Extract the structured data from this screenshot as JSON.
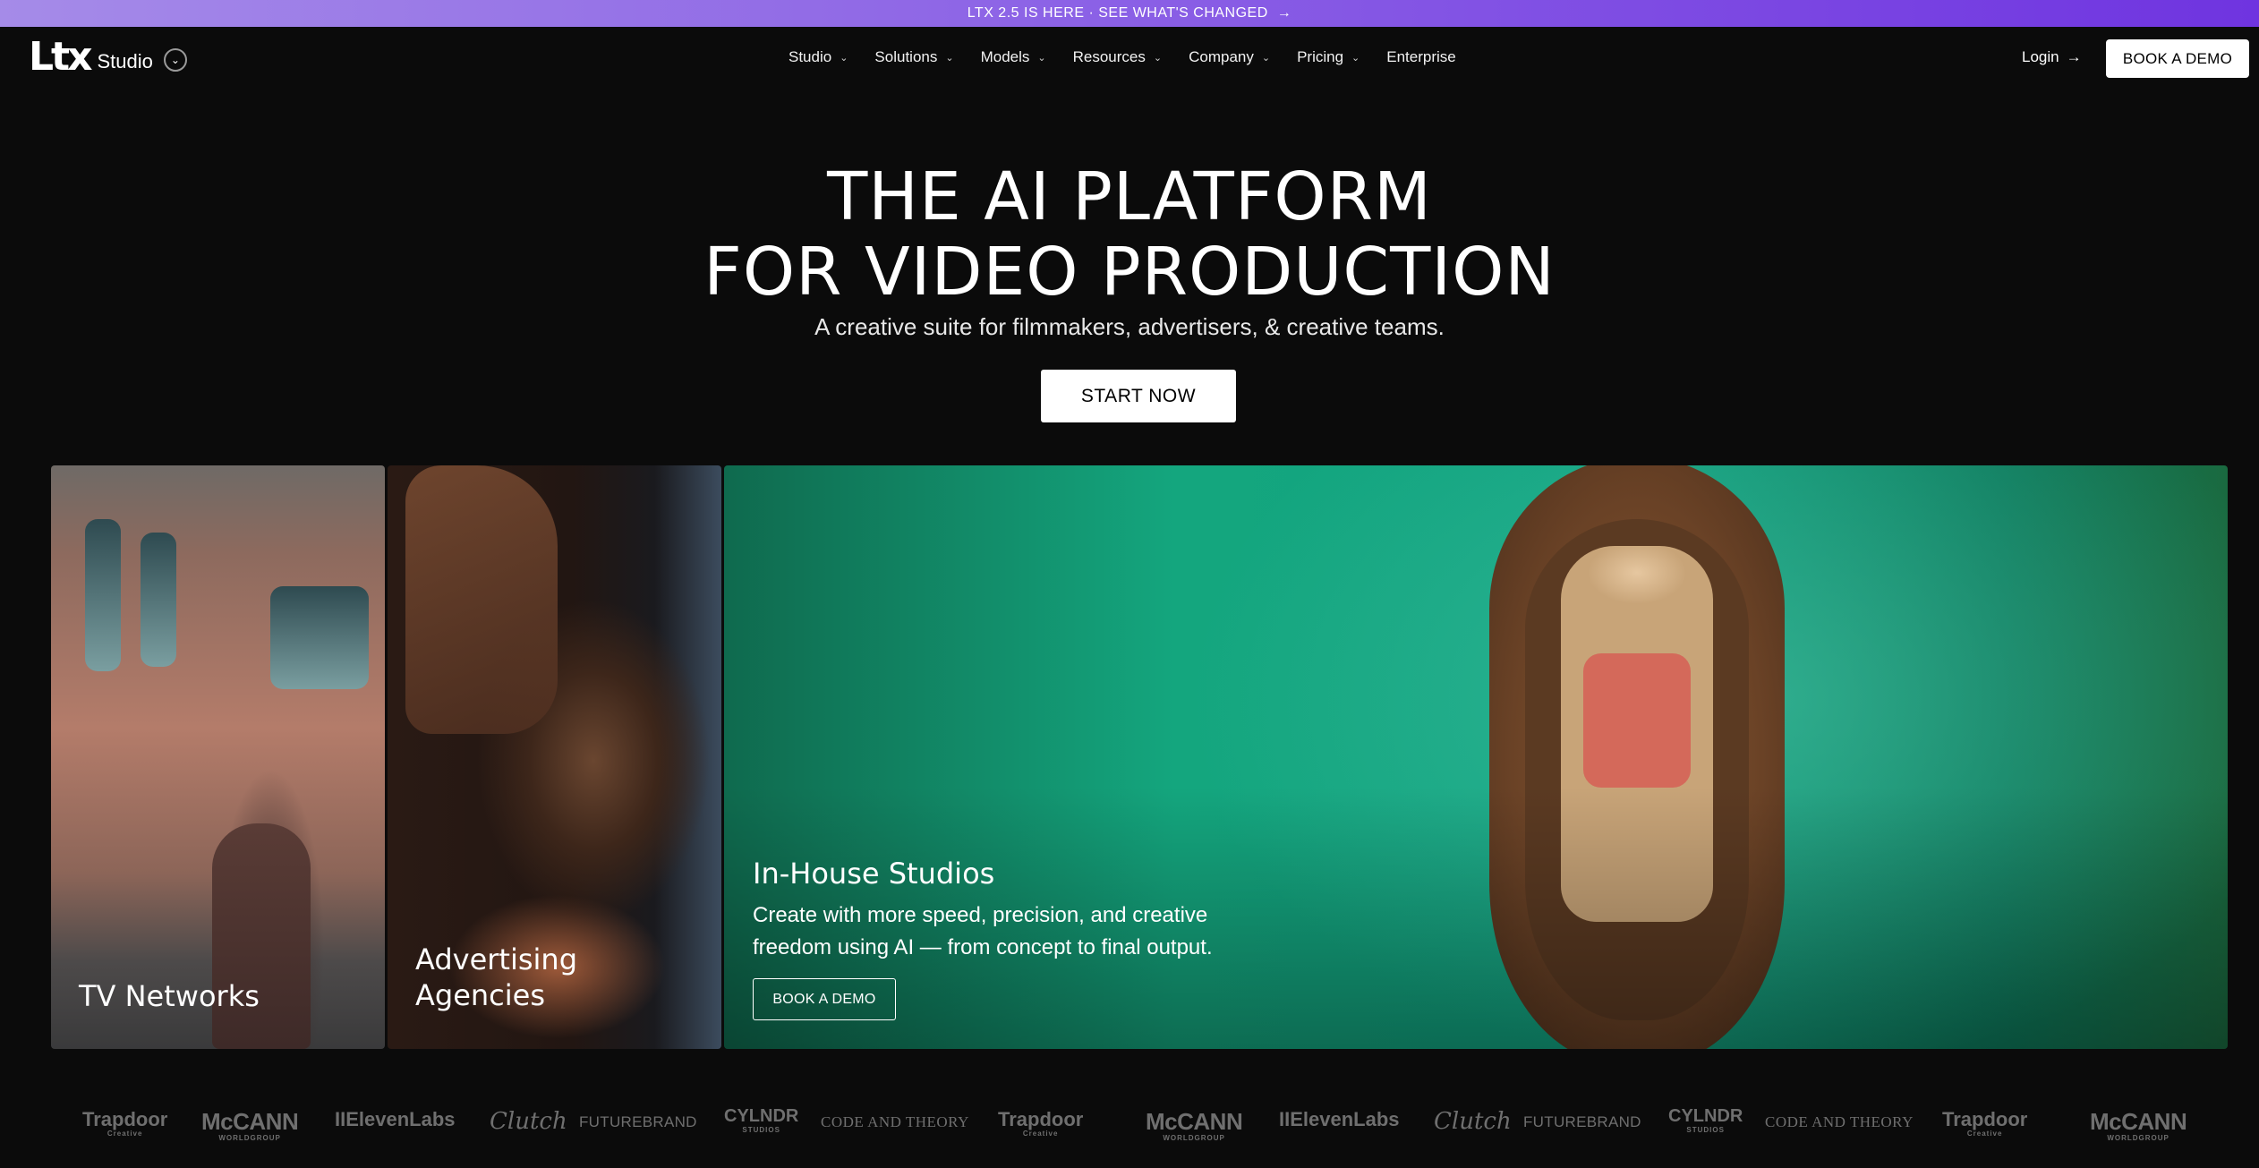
{
  "banner": {
    "text": "LTX 2.5 IS HERE · SEE WHAT'S CHANGED",
    "arrow": "→"
  },
  "nav": {
    "logo_mark": "Ltx",
    "logo_sub": "Studio",
    "logo_caret": "⌄",
    "items": [
      {
        "label": "Studio",
        "has_dropdown": true
      },
      {
        "label": "Solutions",
        "has_dropdown": true
      },
      {
        "label": "Models",
        "has_dropdown": true
      },
      {
        "label": "Resources",
        "has_dropdown": true
      },
      {
        "label": "Company",
        "has_dropdown": true
      },
      {
        "label": "Pricing",
        "has_dropdown": true
      },
      {
        "label": "Enterprise",
        "has_dropdown": false
      }
    ],
    "chevron": "⌄",
    "login_label": "Login",
    "login_arrow": "→",
    "book_demo_label": "BOOK A DEMO"
  },
  "hero": {
    "title_line1": "THE AI PLATFORM",
    "title_line2": "FOR VIDEO PRODUCTION",
    "subtitle": "A creative suite for filmmakers, advertisers, & creative teams.",
    "cta_label": "START NOW"
  },
  "cards": {
    "tv": {
      "label": "TV Networks"
    },
    "ad": {
      "label_line1": "Advertising",
      "label_line2": "Agencies"
    },
    "house": {
      "title": "In-House Studios",
      "description": "Create with more speed, precision, and creative freedom using AI — from concept to final output.",
      "button_label": "BOOK A DEMO"
    }
  },
  "logos": [
    {
      "name": "Trapdoor",
      "sub": "Creative"
    },
    {
      "name": "McCANN",
      "sub": "WORLDGROUP"
    },
    {
      "name": "IIElevenLabs",
      "sub": ""
    },
    {
      "name": "Clutch",
      "sub": ""
    },
    {
      "name": "FUTUREBRAND",
      "sub": ""
    },
    {
      "name": "CYLNDR",
      "sub": "STUDIOS"
    },
    {
      "name": "CODE AND THEORY",
      "sub": ""
    },
    {
      "name": "Trapdoor",
      "sub": "Creative"
    },
    {
      "name": "McCANN",
      "sub": "WORLDGROUP"
    },
    {
      "name": "IIElevenLabs",
      "sub": ""
    },
    {
      "name": "Clutch",
      "sub": ""
    },
    {
      "name": "FUTUREBRAND",
      "sub": ""
    },
    {
      "name": "CYLNDR",
      "sub": "STUDIOS"
    },
    {
      "name": "CODE AND THEORY",
      "sub": ""
    },
    {
      "name": "Trapdoor",
      "sub": "Creative"
    },
    {
      "name": "McCANN",
      "sub": "WORLDGROUP"
    }
  ],
  "colors": {
    "background": "#0b0b0b",
    "banner_start": "#a58be8",
    "banner_end": "#6f34e0",
    "logo_gray": "#6f6f6f"
  }
}
